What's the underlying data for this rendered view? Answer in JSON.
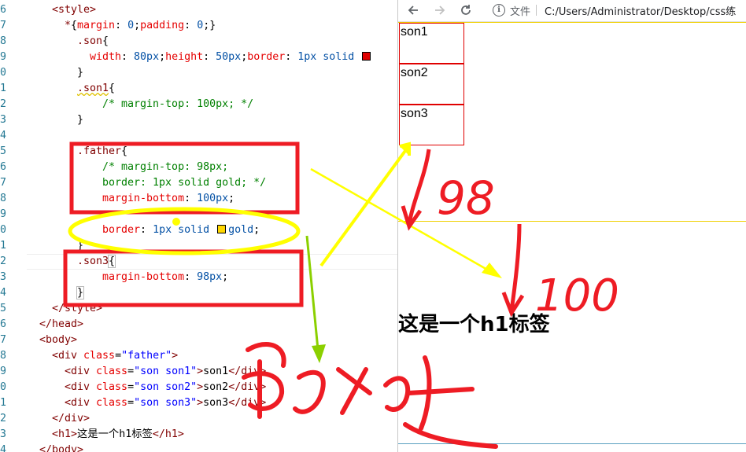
{
  "editor": {
    "lines": [
      {
        "n": "6",
        "indent": 4,
        "segments": [
          {
            "c": "tag",
            "t": "<style>"
          }
        ]
      },
      {
        "n": "7",
        "indent": 6,
        "segments": [
          {
            "c": "sel",
            "t": "*"
          },
          {
            "c": "punc",
            "t": "{"
          },
          {
            "c": "prop",
            "t": "margin"
          },
          {
            "c": "punc",
            "t": ": "
          },
          {
            "c": "val",
            "t": "0"
          },
          {
            "c": "punc",
            "t": ";"
          },
          {
            "c": "prop",
            "t": "padding"
          },
          {
            "c": "punc",
            "t": ": "
          },
          {
            "c": "val",
            "t": "0"
          },
          {
            "c": "punc",
            "t": ";}"
          }
        ]
      },
      {
        "n": "8",
        "indent": 8,
        "segments": [
          {
            "c": "sel",
            "t": ".son"
          },
          {
            "c": "punc",
            "t": "{"
          }
        ]
      },
      {
        "n": "9",
        "indent": 10,
        "segments": [
          {
            "c": "prop",
            "t": "width"
          },
          {
            "c": "punc",
            "t": ": "
          },
          {
            "c": "val",
            "t": "80px"
          },
          {
            "c": "punc",
            "t": ";"
          },
          {
            "c": "prop",
            "t": "height"
          },
          {
            "c": "punc",
            "t": ": "
          },
          {
            "c": "val",
            "t": "50px"
          },
          {
            "c": "punc",
            "t": ";"
          },
          {
            "c": "prop",
            "t": "border"
          },
          {
            "c": "punc",
            "t": ": "
          },
          {
            "c": "val",
            "t": "1px solid "
          },
          {
            "c": "swatch",
            "t": "#e00000"
          }
        ]
      },
      {
        "n": "0",
        "indent": 8,
        "segments": [
          {
            "c": "punc",
            "t": "}"
          }
        ]
      },
      {
        "n": "1",
        "indent": 8,
        "segments": [
          {
            "c": "sel squig",
            "t": ".son1"
          },
          {
            "c": "punc",
            "t": "{"
          }
        ]
      },
      {
        "n": "2",
        "indent": 12,
        "segments": [
          {
            "c": "cmt",
            "t": "/* margin-top: 100px; */"
          }
        ]
      },
      {
        "n": "3",
        "indent": 8,
        "segments": [
          {
            "c": "punc",
            "t": "}"
          }
        ]
      },
      {
        "n": "4",
        "indent": 0,
        "segments": []
      },
      {
        "n": "5",
        "indent": 8,
        "segments": [
          {
            "c": "sel",
            "t": ".father"
          },
          {
            "c": "punc",
            "t": "{"
          }
        ]
      },
      {
        "n": "6",
        "indent": 12,
        "segments": [
          {
            "c": "cmt",
            "t": "/* margin-top: 98px;"
          }
        ]
      },
      {
        "n": "7",
        "indent": 12,
        "segments": [
          {
            "c": "cmt",
            "t": "border: 1px solid gold; */"
          }
        ]
      },
      {
        "n": "8",
        "indent": 12,
        "segments": [
          {
            "c": "prop",
            "t": "margin-bottom"
          },
          {
            "c": "punc",
            "t": ": "
          },
          {
            "c": "val",
            "t": "100px"
          },
          {
            "c": "punc",
            "t": ";"
          }
        ]
      },
      {
        "n": "9",
        "indent": 0,
        "segments": []
      },
      {
        "n": "0",
        "indent": 12,
        "segments": [
          {
            "c": "prop",
            "t": "border"
          },
          {
            "c": "punc",
            "t": ": "
          },
          {
            "c": "val",
            "t": "1px solid "
          },
          {
            "c": "swatch",
            "t": "#ffd700"
          },
          {
            "c": "val",
            "t": "gold"
          },
          {
            "c": "punc",
            "t": ";"
          }
        ]
      },
      {
        "n": "1",
        "indent": 8,
        "segments": [
          {
            "c": "punc",
            "t": "}"
          }
        ]
      },
      {
        "n": "2",
        "indent": 8,
        "segments": [
          {
            "c": "sel",
            "t": ".son3"
          },
          {
            "c": "punc bracket-hl",
            "t": "{"
          }
        ]
      },
      {
        "n": "3",
        "indent": 12,
        "segments": [
          {
            "c": "prop",
            "t": "margin-bottom"
          },
          {
            "c": "punc",
            "t": ": "
          },
          {
            "c": "val",
            "t": "98px"
          },
          {
            "c": "punc",
            "t": ";"
          }
        ]
      },
      {
        "n": "4",
        "indent": 8,
        "segments": [
          {
            "c": "punc bracket-hl",
            "t": "}"
          }
        ]
      },
      {
        "n": "5",
        "indent": 4,
        "segments": [
          {
            "c": "tag",
            "t": "</style>"
          }
        ]
      },
      {
        "n": "6",
        "indent": 2,
        "segments": [
          {
            "c": "tag",
            "t": "</head>"
          }
        ]
      },
      {
        "n": "7",
        "indent": 2,
        "segments": [
          {
            "c": "tag",
            "t": "<body>"
          }
        ]
      },
      {
        "n": "8",
        "indent": 4,
        "segments": [
          {
            "c": "tag",
            "t": "<div "
          },
          {
            "c": "attr",
            "t": "class"
          },
          {
            "c": "punc",
            "t": "="
          },
          {
            "c": "str",
            "t": "\"father\""
          },
          {
            "c": "tag",
            "t": ">"
          }
        ]
      },
      {
        "n": "9",
        "indent": 6,
        "segments": [
          {
            "c": "tag",
            "t": "<div "
          },
          {
            "c": "attr",
            "t": "class"
          },
          {
            "c": "punc",
            "t": "="
          },
          {
            "c": "str",
            "t": "\"son son1\""
          },
          {
            "c": "tag",
            "t": ">"
          },
          {
            "c": "txt",
            "t": "son1"
          },
          {
            "c": "tag",
            "t": "</div>"
          }
        ]
      },
      {
        "n": "0",
        "indent": 6,
        "segments": [
          {
            "c": "tag",
            "t": "<div "
          },
          {
            "c": "attr",
            "t": "class"
          },
          {
            "c": "punc",
            "t": "="
          },
          {
            "c": "str",
            "t": "\"son son2\""
          },
          {
            "c": "tag",
            "t": ">"
          },
          {
            "c": "txt",
            "t": "son2"
          },
          {
            "c": "tag",
            "t": "</div>"
          }
        ]
      },
      {
        "n": "1",
        "indent": 6,
        "segments": [
          {
            "c": "tag",
            "t": "<div "
          },
          {
            "c": "attr",
            "t": "class"
          },
          {
            "c": "punc",
            "t": "="
          },
          {
            "c": "str",
            "t": "\"son son3\""
          },
          {
            "c": "tag",
            "t": ">"
          },
          {
            "c": "txt",
            "t": "son3"
          },
          {
            "c": "tag",
            "t": "</div>"
          }
        ]
      },
      {
        "n": "2",
        "indent": 4,
        "segments": [
          {
            "c": "tag",
            "t": "</div>"
          }
        ]
      },
      {
        "n": "3",
        "indent": 4,
        "segments": [
          {
            "c": "tag",
            "t": "<h1>"
          },
          {
            "c": "txt",
            "t": "这是一个h1标签"
          },
          {
            "c": "tag",
            "t": "</h1>"
          }
        ]
      },
      {
        "n": "4",
        "indent": 2,
        "segments": [
          {
            "c": "tag",
            "t": "</body>"
          }
        ]
      }
    ]
  },
  "browser": {
    "back_icon": "arrow-left-icon",
    "forward_icon": "arrow-right-icon",
    "reload_icon": "reload-icon",
    "info_icon": "info-circle-icon",
    "file_label": "文件",
    "url": "C:/Users/Administrator/Desktop/css练",
    "page": {
      "sons": [
        "son1",
        "son2",
        "son3"
      ],
      "h1": "这是一个h1标签"
    }
  },
  "annotations": {
    "label_98": "98",
    "label_100": "100",
    "pen_red": "#ff1a1a",
    "pen_yellow": "#ffff00",
    "pen_green": "#8bd000"
  }
}
